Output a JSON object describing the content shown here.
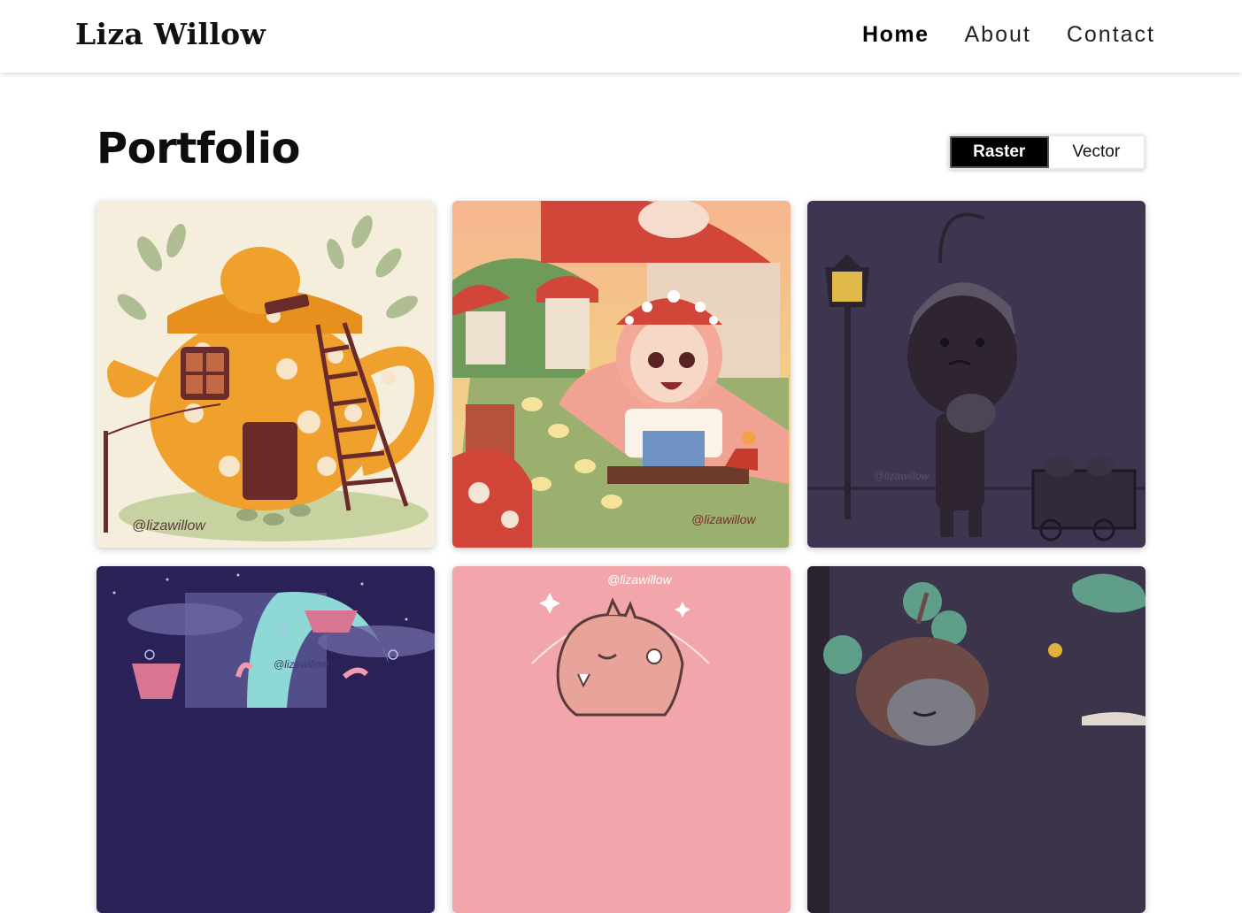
{
  "header": {
    "brand": "Liza Willow",
    "nav": [
      {
        "label": "Home",
        "active": true
      },
      {
        "label": "About",
        "active": false
      },
      {
        "label": "Contact",
        "active": false
      }
    ]
  },
  "main": {
    "title": "Portfolio",
    "filter": {
      "options": [
        "Raster",
        "Vector"
      ],
      "selected": "Raster"
    },
    "gallery": [
      {
        "subject": "teapot-house illustration",
        "watermark": "@lizawillow"
      },
      {
        "subject": "mushroom-girl illustration",
        "watermark": "@lizawillow"
      },
      {
        "subject": "night lamppost boy illustration",
        "watermark": "@lizawillow"
      },
      {
        "subject": "moon and floating islands illustration",
        "watermark": "@lizawillow"
      },
      {
        "subject": "pink dinosaur illustration",
        "watermark": "@lizawillow"
      },
      {
        "subject": "night forest character illustration",
        "watermark": ""
      }
    ]
  },
  "colors": {
    "accent": "#000000",
    "nav_text": "#222222",
    "background": "#ffffff"
  }
}
